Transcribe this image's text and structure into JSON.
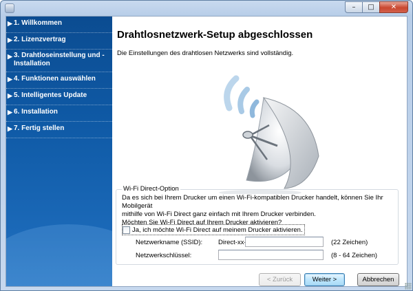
{
  "window": {
    "controls": {
      "minimize": "–",
      "maximize": "□",
      "close": "✕"
    }
  },
  "sidebar": {
    "items": [
      {
        "label": "1. Willkommen"
      },
      {
        "label": "2. Lizenzvertrag"
      },
      {
        "label": "3. Drahtloseinstellung und -Installation"
      },
      {
        "label": "4. Funktionen auswählen"
      },
      {
        "label": "5. Intelligentes Update"
      },
      {
        "label": "6. Installation"
      },
      {
        "label": "7. Fertig stellen"
      }
    ],
    "arrow": "▶"
  },
  "main": {
    "title": "Drahtlosnetzwerk-Setup abgeschlossen",
    "subtitle": "Die Einstellungen des drahtlosen Netzwerks sind vollständig.",
    "illustration_icon": "satellite-dish-icon"
  },
  "wifi_direct": {
    "legend": "Wi-Fi Direct-Option",
    "description_line1": "Da es sich bei Ihrem Drucker um einen Wi-Fi-kompatiblen Drucker handelt, können Sie Ihr Mobilgerät",
    "description_line2": "mithilfe von Wi-Fi Direct ganz einfach mit Ihrem Drucker verbinden.",
    "description_line3": "Möchten Sie Wi-Fi Direct auf Ihrem Drucker aktivieren?",
    "checkbox_label": "Ja, ich möchte Wi-Fi Direct auf meinem Drucker aktivieren.",
    "checkbox_checked": false,
    "ssid_label": "Netzwerkname (SSID):",
    "ssid_prefix": "Direct-xx-",
    "ssid_value": "",
    "ssid_hint": "(22 Zeichen)",
    "key_label": "Netzwerkschlüssel:",
    "key_value": "",
    "key_hint": "(8 - 64 Zeichen)"
  },
  "buttons": {
    "back": "< Zurück",
    "next": "Weiter >",
    "cancel": "Abbrechen"
  },
  "colors": {
    "sidebar_top": "#0b4c91",
    "sidebar_bottom": "#2a78c4",
    "wave": "#8fb8dc"
  }
}
